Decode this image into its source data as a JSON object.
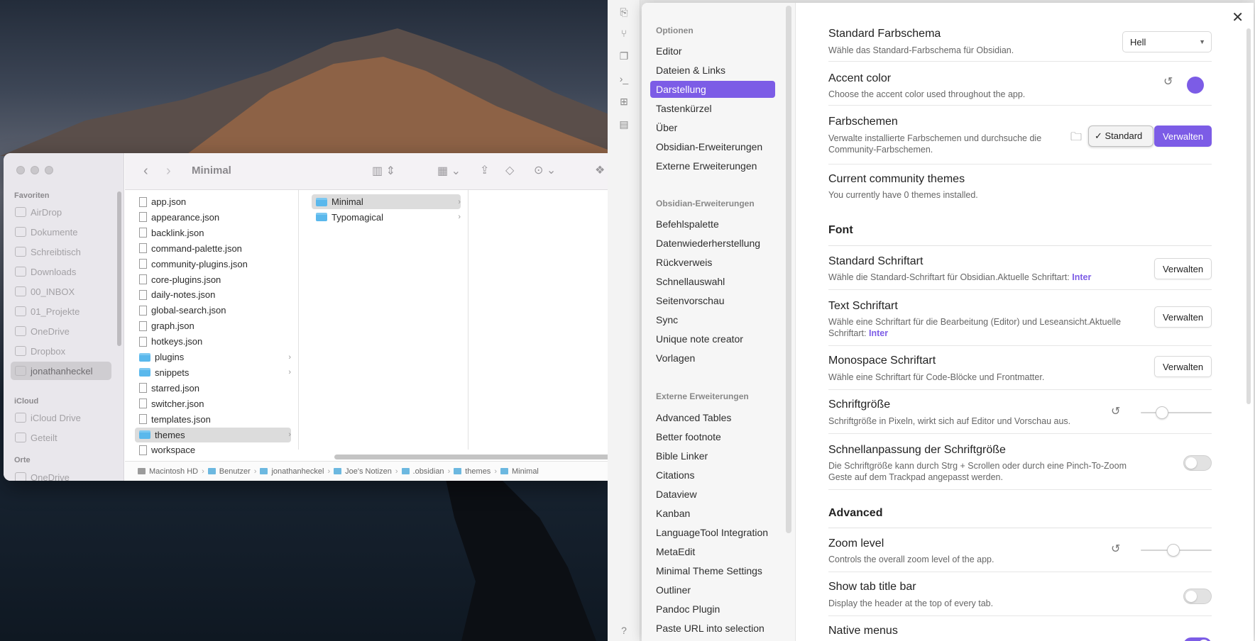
{
  "finder": {
    "title": "Minimal",
    "sidebar": {
      "favorites_label": "Favoriten",
      "favorites": [
        "AirDrop",
        "Dokumente",
        "Schreibtisch",
        "Downloads",
        "00_INBOX",
        "01_Projekte",
        "OneDrive",
        "Dropbox",
        "jonathanheckel"
      ],
      "icloud_label": "iCloud",
      "icloud": [
        "iCloud Drive",
        "Geteilt"
      ],
      "orte_label": "Orte",
      "orte": [
        "OneDrive"
      ]
    },
    "column1": [
      {
        "name": "app.json",
        "type": "file"
      },
      {
        "name": "appearance.json",
        "type": "file"
      },
      {
        "name": "backlink.json",
        "type": "file"
      },
      {
        "name": "command-palette.json",
        "type": "file"
      },
      {
        "name": "community-plugins.json",
        "type": "file"
      },
      {
        "name": "core-plugins.json",
        "type": "file"
      },
      {
        "name": "daily-notes.json",
        "type": "file"
      },
      {
        "name": "global-search.json",
        "type": "file"
      },
      {
        "name": "graph.json",
        "type": "file"
      },
      {
        "name": "hotkeys.json",
        "type": "file"
      },
      {
        "name": "plugins",
        "type": "folder"
      },
      {
        "name": "snippets",
        "type": "folder"
      },
      {
        "name": "starred.json",
        "type": "file"
      },
      {
        "name": "switcher.json",
        "type": "file"
      },
      {
        "name": "templates.json",
        "type": "file"
      },
      {
        "name": "themes",
        "type": "folder",
        "selected": true
      },
      {
        "name": "workspace",
        "type": "file"
      }
    ],
    "column2": [
      {
        "name": "Minimal",
        "type": "folder",
        "selected": true
      },
      {
        "name": "Typomagical",
        "type": "folder"
      }
    ],
    "path": [
      "Macintosh HD",
      "Benutzer",
      "jonathanheckel",
      "Joe's Notizen",
      ".obsidian",
      "themes",
      "Minimal"
    ]
  },
  "obsidian": {
    "nav": {
      "group1_label": "Optionen",
      "group1": [
        "Editor",
        "Dateien & Links",
        "Darstellung",
        "Tastenkürzel",
        "Über",
        "Obsidian-Erweiterungen",
        "Externe Erweiterungen"
      ],
      "active": "Darstellung",
      "group2_label": "Obsidian-Erweiterungen",
      "group2": [
        "Befehlspalette",
        "Datenwiederherstellung",
        "Rückverweis",
        "Schnellauswahl",
        "Seitenvorschau",
        "Sync",
        "Unique note creator",
        "Vorlagen"
      ],
      "group3_label": "Externe Erweiterungen",
      "group3": [
        "Advanced Tables",
        "Better footnote",
        "Bible Linker",
        "Citations",
        "Dataview",
        "Kanban",
        "LanguageTool Integration",
        "MetaEdit",
        "Minimal Theme Settings",
        "Outliner",
        "Pandoc Plugin",
        "Paste URL into selection"
      ]
    },
    "settings": {
      "farbschema": {
        "name": "Standard Farbschema",
        "desc": "Wähle das Standard-Farbschema für Obsidian.",
        "value": "Hell"
      },
      "accent": {
        "name": "Accent color",
        "desc": "Choose the accent color used throughout the app.",
        "color": "#7c5ce6"
      },
      "farbschemen": {
        "name": "Farbschemen",
        "desc": "Verwalte installierte Farbschemen und durchsuche die Community-Farbschemen.",
        "select": "✓ Standard",
        "button": "Verwalten"
      },
      "community": {
        "name": "Current community themes",
        "desc": "You currently have 0 themes installed."
      },
      "font_section": "Font",
      "std_font": {
        "name": "Standard Schriftart",
        "desc": "Wähle die Standard-Schriftart für Obsidian.Aktuelle Schriftart: ",
        "current": "Inter",
        "button": "Verwalten"
      },
      "text_font": {
        "name": "Text Schriftart",
        "desc": "Wähle eine Schriftart für die Bearbeitung (Editor) und Leseansicht.Aktuelle Schriftart: ",
        "current": "Inter",
        "button": "Verwalten"
      },
      "mono_font": {
        "name": "Monospace Schriftart",
        "desc": "Wähle eine Schriftart für Code-Blöcke und Frontmatter.",
        "button": "Verwalten"
      },
      "font_size": {
        "name": "Schriftgröße",
        "desc": "Schriftgröße in Pixeln, wirkt sich auf Editor und Vorschau aus.",
        "level": 0.25
      },
      "quick_font": {
        "name": "Schnellanpassung der Schriftgröße",
        "desc": "Die Schriftgröße kann durch Strg + Scrollen oder durch eine Pinch-To-Zoom Geste auf dem Trackpad angepasst werden.",
        "on": false
      },
      "advanced_section": "Advanced",
      "zoom": {
        "name": "Zoom level",
        "desc": "Controls the overall zoom level of the app.",
        "level": 0.45
      },
      "tab_title": {
        "name": "Show tab title bar",
        "desc": "Display the header at the top of every tab.",
        "on": false
      },
      "native_menus": {
        "name": "Native menus",
        "on": true
      }
    }
  }
}
